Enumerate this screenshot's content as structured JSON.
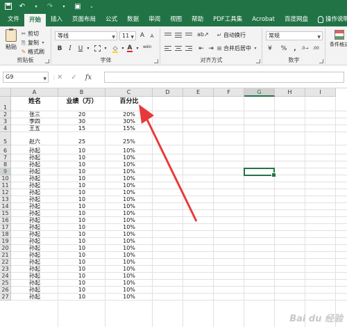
{
  "titlebar": {
    "undo_icon": "undo-icon",
    "redo_icon": "redo-icon",
    "camera_icon": "camera-icon"
  },
  "tabs": [
    "文件",
    "开始",
    "插入",
    "页面布局",
    "公式",
    "数据",
    "审阅",
    "视图",
    "帮助",
    "PDF工具集",
    "Acrobat",
    "百度网盘",
    "操作说明搜"
  ],
  "active_tab": 1,
  "ribbon": {
    "clipboard": {
      "paste": "粘贴",
      "cut": "剪切",
      "copy": "复制",
      "format_painter": "格式刷",
      "label": "剪贴板"
    },
    "font": {
      "name": "等线",
      "size": "11",
      "bold": "B",
      "italic": "I",
      "underline": "U",
      "grow": "A",
      "shrink": "A",
      "color": "A",
      "wen": "wén",
      "label": "字体"
    },
    "alignment": {
      "wrap": "自动换行",
      "merge": "合并后居中",
      "label": "对齐方式"
    },
    "number": {
      "format": "常规",
      "label": "数字"
    },
    "styles": {
      "conditional": "条件格式"
    }
  },
  "formula_bar": {
    "cell_ref": "G9",
    "cancel": "✕",
    "enter": "✓",
    "fx": "fx",
    "value": ""
  },
  "columns": [
    "A",
    "B",
    "C",
    "D",
    "E",
    "F",
    "G",
    "H",
    "I"
  ],
  "selected_col": "G",
  "selected_row": "9",
  "rows": [
    "1",
    "2",
    "3",
    "4",
    "5",
    "6",
    "7",
    "8",
    "9",
    "10",
    "11",
    "12",
    "13",
    "14",
    "15",
    "16",
    "17",
    "18",
    "19",
    "20",
    "21",
    "22",
    "23",
    "24",
    "25",
    "26",
    "27"
  ],
  "table": {
    "headers": [
      "姓名",
      "业绩（万）",
      "百分比"
    ],
    "data": [
      [
        "张三",
        "20",
        "20%"
      ],
      [
        "李四",
        "30",
        "30%"
      ],
      [
        "王五",
        "15",
        "15%"
      ],
      [
        "赵六",
        "25",
        "25%"
      ],
      [
        "孙起",
        "10",
        "10%"
      ],
      [
        "孙起",
        "10",
        "10%"
      ],
      [
        "孙起",
        "10",
        "10%"
      ],
      [
        "孙起",
        "10",
        "10%"
      ],
      [
        "孙起",
        "10",
        "10%"
      ],
      [
        "孙起",
        "10",
        "10%"
      ],
      [
        "孙起",
        "10",
        "10%"
      ],
      [
        "孙起",
        "10",
        "10%"
      ],
      [
        "孙起",
        "10",
        "10%"
      ],
      [
        "孙起",
        "10",
        "10%"
      ],
      [
        "孙起",
        "10",
        "10%"
      ],
      [
        "孙起",
        "10",
        "10%"
      ],
      [
        "孙起",
        "10",
        "10%"
      ],
      [
        "孙起",
        "10",
        "10%"
      ],
      [
        "孙起",
        "10",
        "10%"
      ],
      [
        "孙起",
        "10",
        "10%"
      ],
      [
        "孙起",
        "10",
        "10%"
      ],
      [
        "孙起",
        "10",
        "10%"
      ],
      [
        "孙起",
        "10",
        "10%"
      ],
      [
        "孙起",
        "10",
        "10%"
      ],
      [
        "孙起",
        "10",
        "10%"
      ],
      [
        "孙起",
        "10",
        "10%"
      ]
    ]
  },
  "watermark": "Bai du 经验",
  "colors": {
    "excel_green": "#217346",
    "annotation_red": "#e8393a"
  }
}
